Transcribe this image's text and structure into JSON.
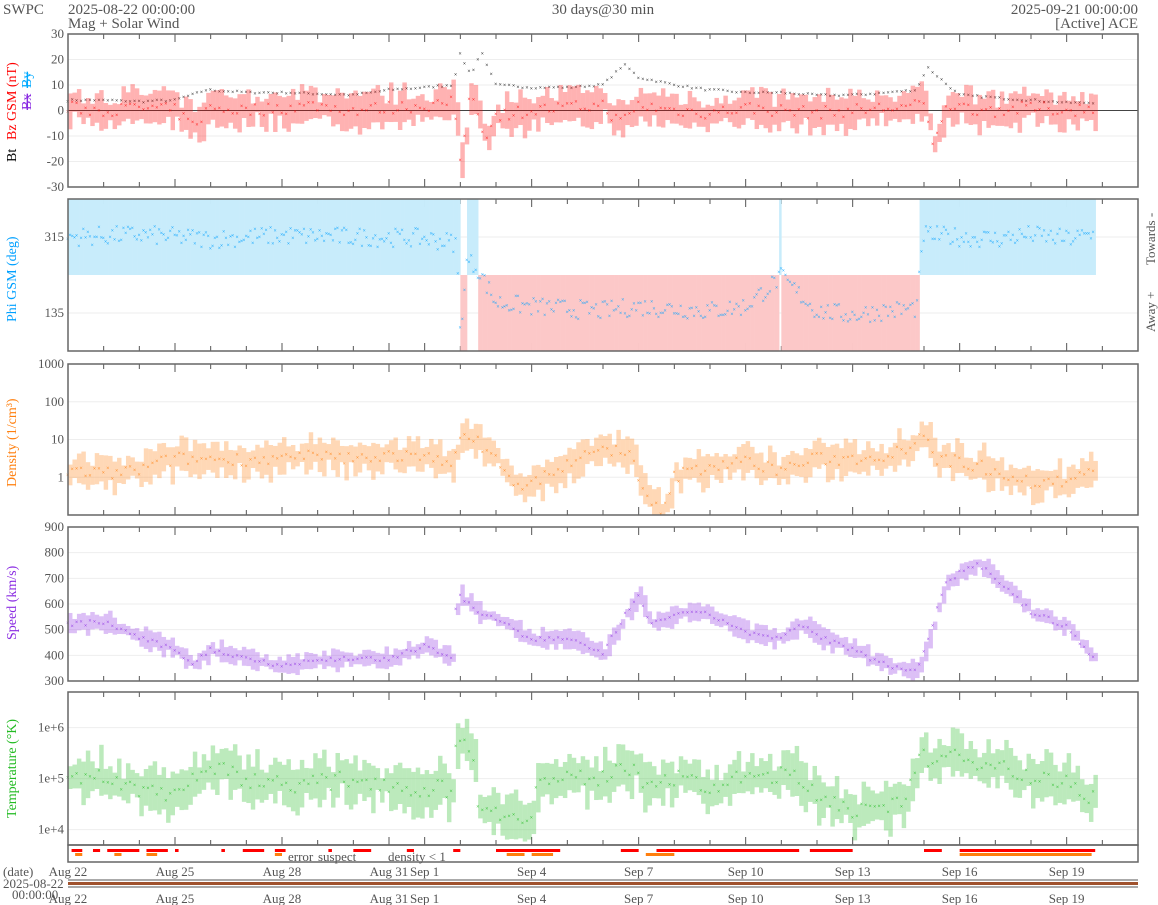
{
  "header": {
    "org": "SWPC",
    "start": "2025-08-22 00:00:00",
    "subtitle": "Mag + Solar Wind",
    "span": "30 days@30 min",
    "end": "2025-09-21 00:00:00",
    "source": "[Active] ACE"
  },
  "colors": {
    "bt": "#000000",
    "bz": "#ff0000",
    "bx": "#8a2be2",
    "by": "#00aaff",
    "phi": "#00a0ff",
    "phi_towards": "#c8ecfb",
    "phi_away": "#fcc8c8",
    "density": "#ff7f0e",
    "speed": "#8a2be2",
    "temp": "#22bb22",
    "error": "#ff0000",
    "suspect": "#ffcc00",
    "lowdens": "#ff7f0e",
    "datebar": "#a0522d"
  },
  "chart_data": [
    {
      "type": "line",
      "name": "mag",
      "ylabel_bt": "Bt",
      "ylabel_bz": "Bz GSM (nT)",
      "ylabel_bx": "Bx",
      "ylabel_by": "By",
      "ylim": [
        -30,
        30
      ],
      "yticks": [
        "30",
        "20",
        "10",
        "0",
        "-10",
        "-20",
        "-30"
      ],
      "ytick_values": [
        30,
        20,
        10,
        0,
        -10,
        -20,
        -30
      ],
      "series": [
        {
          "name": "Bt",
          "x": [
            0,
            1,
            2,
            3,
            3.9,
            5,
            6,
            7,
            8,
            9,
            10,
            10.8,
            11.0,
            11.3,
            11.6,
            12,
            13,
            14,
            15,
            15.6,
            16,
            17,
            18,
            19,
            20,
            21,
            22,
            23,
            23.8,
            24.1,
            24.5,
            25,
            26,
            27,
            28,
            28.8
          ],
          "y": [
            4,
            4,
            3.5,
            4,
            8,
            7,
            7,
            6.5,
            6,
            8,
            9,
            10,
            22,
            14,
            23,
            10,
            9,
            9,
            10,
            18,
            13,
            10,
            8,
            7,
            7,
            6,
            6,
            7,
            8,
            17,
            12,
            6,
            5,
            4,
            3,
            3
          ]
        },
        {
          "name": "Bz",
          "x": [
            0,
            1,
            2,
            3,
            3.5,
            4,
            5,
            6,
            7,
            8,
            9,
            10,
            10.8,
            11.0,
            11.3,
            11.7,
            12,
            13,
            14,
            15,
            15.5,
            16,
            17,
            18,
            19,
            20,
            21,
            22,
            23,
            24,
            24.3,
            24.6,
            25,
            26,
            27,
            28,
            28.8
          ],
          "y": [
            1,
            0,
            1,
            0,
            -6,
            1,
            0,
            1,
            2,
            0,
            1,
            2,
            3,
            -20,
            8,
            -10,
            -2,
            0,
            1,
            2,
            -5,
            2,
            0,
            -1,
            1,
            0,
            -1,
            0,
            1,
            2,
            -15,
            3,
            1,
            0,
            1,
            0,
            1
          ]
        }
      ]
    },
    {
      "type": "scatter",
      "name": "phi",
      "ylabel": "Phi GSM (deg)",
      "right_top": "Towards -",
      "right_bottom": "Away +",
      "ylim": [
        45,
        405
      ],
      "yticks": [
        "315",
        "135"
      ],
      "ytick_values": [
        315,
        135
      ],
      "x": [
        0,
        2,
        4,
        6,
        8,
        10,
        10.9,
        11.0,
        11.2,
        11.5,
        12,
        13,
        14,
        15,
        16,
        17,
        18,
        19,
        20,
        21,
        22,
        23,
        23.8,
        24,
        25,
        26,
        27,
        28,
        28.8
      ],
      "y": [
        315,
        320,
        310,
        318,
        315,
        312,
        300,
        90,
        260,
        240,
        160,
        150,
        145,
        140,
        150,
        145,
        140,
        150,
        220,
        140,
        130,
        140,
        145,
        320,
        315,
        310,
        320,
        310,
        320
      ]
    },
    {
      "type": "line",
      "name": "density",
      "ylabel": "Density (1/cm³)",
      "scale": "log",
      "ylim": [
        0.1,
        1000
      ],
      "yticks": [
        "1000",
        "100",
        "10",
        "1"
      ],
      "ytick_values": [
        1000,
        100,
        10,
        1
      ],
      "x": [
        0,
        1,
        2,
        3,
        4,
        5,
        6,
        7,
        8,
        9,
        10,
        10.8,
        11,
        11.5,
        12,
        12.5,
        13,
        14,
        15,
        15.5,
        16,
        16.3,
        16.8,
        17,
        18,
        19,
        20,
        21,
        22,
        23,
        23.5,
        24,
        24.3,
        25,
        26,
        27,
        28,
        28.8
      ],
      "y": [
        1.5,
        1.2,
        1.5,
        3,
        3,
        3,
        3,
        3.5,
        3,
        4,
        3,
        3,
        10,
        8,
        3,
        0.5,
        0.6,
        2,
        5,
        6,
        0.8,
        0.15,
        0.15,
        1,
        2,
        2.5,
        1.5,
        3,
        3,
        4,
        6,
        15,
        3,
        2.5,
        1.5,
        0.7,
        0.8,
        1.3
      ]
    },
    {
      "type": "line",
      "name": "speed",
      "ylabel": "Speed (km/s)",
      "ylim": [
        300,
        900
      ],
      "yticks": [
        "900",
        "800",
        "700",
        "600",
        "500",
        "400",
        "300"
      ],
      "ytick_values": [
        900,
        800,
        700,
        600,
        500,
        400,
        300
      ],
      "x": [
        0,
        1,
        2,
        3,
        3.5,
        4,
        5,
        6,
        7,
        8,
        9,
        10,
        10.8,
        10.9,
        11.5,
        12,
        13,
        14,
        15,
        15.5,
        16,
        16.3,
        17,
        18,
        19,
        20,
        20.5,
        21,
        22,
        23,
        23.8,
        24.2,
        24.6,
        25,
        25.5,
        26,
        27,
        28,
        28.8
      ],
      "y": [
        520,
        530,
        470,
        420,
        370,
        420,
        390,
        360,
        380,
        390,
        380,
        440,
        390,
        640,
        570,
        540,
        460,
        470,
        400,
        530,
        630,
        520,
        560,
        560,
        490,
        460,
        520,
        480,
        420,
        360,
        340,
        500,
        680,
        720,
        760,
        700,
        570,
        510,
        380
      ]
    },
    {
      "type": "line",
      "name": "temperature",
      "ylabel": "Temperature (°K)",
      "scale": "log",
      "ylim": [
        5000,
        5000000
      ],
      "yticks": [
        "1e+6",
        "1e+5",
        "1e+4"
      ],
      "ytick_values": [
        1000000,
        100000,
        10000
      ],
      "x": [
        0,
        1,
        2,
        3,
        4,
        5,
        6,
        7,
        8,
        9,
        9.5,
        10,
        10.8,
        10.9,
        11.3,
        11.5,
        12,
        13,
        13.2,
        14,
        15,
        15.5,
        16,
        17,
        18,
        19,
        20,
        21,
        22,
        23,
        23.5,
        24,
        25,
        26,
        27,
        28,
        28.8
      ],
      "y": [
        125000,
        100000,
        63000,
        50000,
        160000,
        100000,
        80000,
        80000,
        100000,
        80000,
        63000,
        63000,
        63000,
        800000,
        250000,
        40000,
        20000,
        20000,
        80000,
        100000,
        100000,
        200000,
        100000,
        100000,
        63000,
        100000,
        125000,
        50000,
        25000,
        20000,
        50000,
        250000,
        250000,
        200000,
        100000,
        80000,
        40000
      ]
    },
    {
      "type": "table",
      "name": "status",
      "legend": [
        "error",
        "suspect",
        "density < 1"
      ],
      "error_ranges": [
        [
          0.1,
          0.4
        ],
        [
          0.7,
          0.9
        ],
        [
          1.1,
          2.0
        ],
        [
          2.2,
          2.8
        ],
        [
          3.0,
          3.1
        ],
        [
          4.3,
          4.4
        ],
        [
          4.9,
          5.5
        ],
        [
          5.8,
          6.1
        ],
        [
          7.3,
          7.4
        ],
        [
          8.0,
          8.5
        ],
        [
          9.5,
          9.7
        ],
        [
          10.8,
          11.0
        ],
        [
          12.0,
          13.8
        ],
        [
          15.5,
          16.0
        ],
        [
          16.5,
          20.5
        ],
        [
          20.8,
          22.0
        ],
        [
          24.0,
          24.5
        ],
        [
          25.0,
          28.8
        ]
      ],
      "lowdens_ranges": [
        [
          0.2,
          0.4
        ],
        [
          1.3,
          1.5
        ],
        [
          2.2,
          2.5
        ],
        [
          5.8,
          6.0
        ],
        [
          12.3,
          12.8
        ],
        [
          13.0,
          13.6
        ],
        [
          16.2,
          17.0
        ],
        [
          25.0,
          28.7
        ]
      ]
    },
    {
      "type": "axis",
      "name": "dates",
      "xlabel": "(date)",
      "start_label": "2025-08-22",
      "start_time": "00:00:00",
      "xlim_days": [
        0,
        30
      ],
      "ticks": [
        "Aug 22",
        "Aug 25",
        "Aug 28",
        "Aug 31",
        "Sep 1",
        "Sep 4",
        "Sep 7",
        "Sep 10",
        "Sep 13",
        "Sep 16",
        "Sep 19"
      ],
      "tick_days": [
        0,
        3,
        6,
        9,
        10,
        13,
        16,
        19,
        22,
        25,
        28
      ]
    }
  ]
}
